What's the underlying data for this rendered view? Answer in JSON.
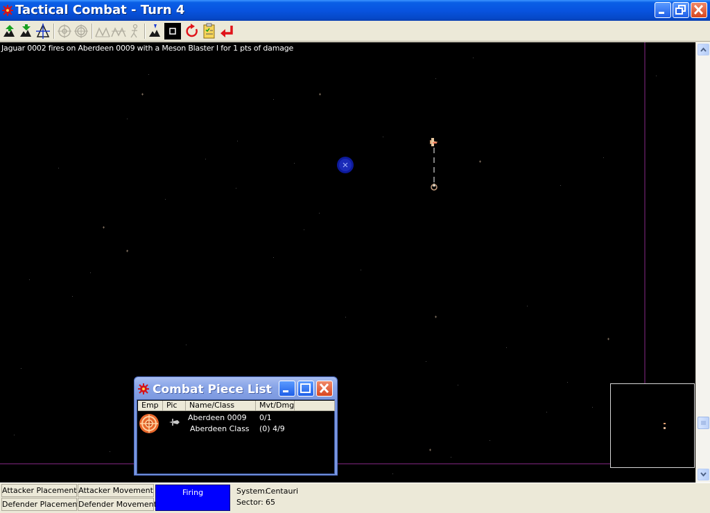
{
  "window": {
    "title": "Tactical Combat - Turn 4"
  },
  "toolbar": {
    "buttons": [
      {
        "name": "move-up-icon",
        "enabled": true
      },
      {
        "name": "move-down-icon",
        "enabled": true
      },
      {
        "name": "formation-icon",
        "enabled": true
      },
      {
        "name": "target-icon",
        "enabled": false
      },
      {
        "name": "target-all-icon",
        "enabled": false
      },
      {
        "name": "wave-icon",
        "enabled": false
      },
      {
        "name": "wave-all-icon",
        "enabled": false
      },
      {
        "name": "retreat-icon",
        "enabled": false
      },
      {
        "name": "ship-icon",
        "enabled": true
      },
      {
        "name": "stop-icon",
        "enabled": true
      },
      {
        "name": "refresh-icon",
        "enabled": true
      },
      {
        "name": "clipboard-icon",
        "enabled": true
      },
      {
        "name": "end-turn-icon",
        "enabled": true
      }
    ]
  },
  "map": {
    "status_message": "Jaguar 0002 fires on Aberdeen 0009 with a Meson Blaster I for 1 pts of damage"
  },
  "combat_list": {
    "title": "Combat Piece List",
    "columns": [
      "Emp",
      "Pic",
      "Name/Class",
      "Mvt/Dmg"
    ],
    "rows": [
      {
        "name": "Aberdeen 0009",
        "class": "Aberdeen Class",
        "mvt": "0/1",
        "dmg": "(0) 4/9"
      }
    ]
  },
  "phases": {
    "attacker_placement": "Attacker Placement",
    "attacker_movement": "Attacker Movement",
    "defender_placement": "Defender Placement",
    "defender_movement": "Defender Movement",
    "firing": "Firing"
  },
  "info": {
    "system_label": "System:",
    "system_value": "Centauri",
    "sector_label": "Sector:",
    "sector_value": "65"
  },
  "colors": {
    "active_phase": "#0000ff",
    "boundary": "#8a2a8a",
    "selection": "#1a2aa8"
  }
}
